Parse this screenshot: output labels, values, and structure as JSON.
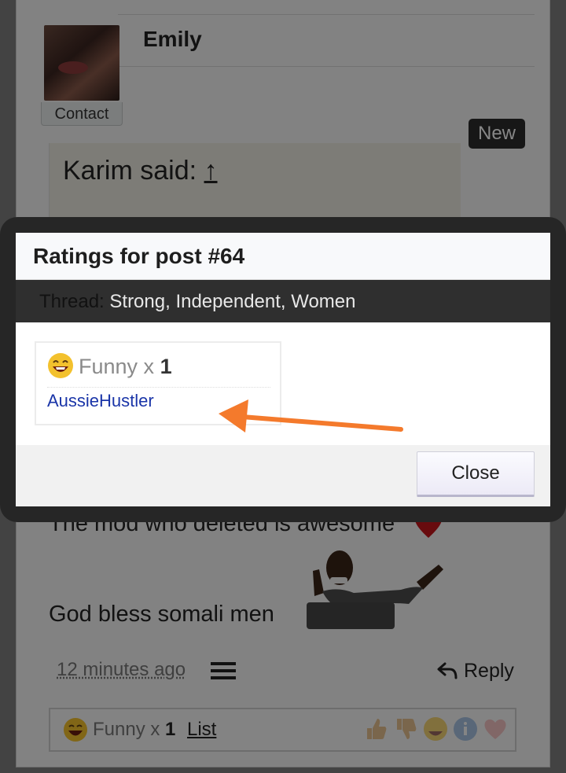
{
  "post": {
    "author": "Emily",
    "contact_label": "Contact",
    "badge": "New",
    "quote_author": "Karim said:",
    "quote_link": "↑",
    "text_line1": "The mod who deleted is awesome",
    "text_line2": "God bless somali men",
    "timestamp": "12 minutes ago",
    "reply_label": "Reply"
  },
  "ratings_bar": {
    "label": "Funny x",
    "count": "1",
    "list_label": "List",
    "icons": [
      "thumbs-up-icon",
      "thumbs-down-icon",
      "funny-icon",
      "info-icon",
      "heart-icon"
    ]
  },
  "modal": {
    "title": "Ratings for post #64",
    "thread_label": "Thread:",
    "thread_name": "Strong, Independent, Women",
    "rating_label": "Funny x",
    "rating_count": "1",
    "rater": "AussieHustler",
    "close_label": "Close"
  },
  "colors": {
    "annotation_arrow": "#f47a2c",
    "rater_link": "#1a35a8",
    "thread_bar": "#2f2f2f"
  }
}
